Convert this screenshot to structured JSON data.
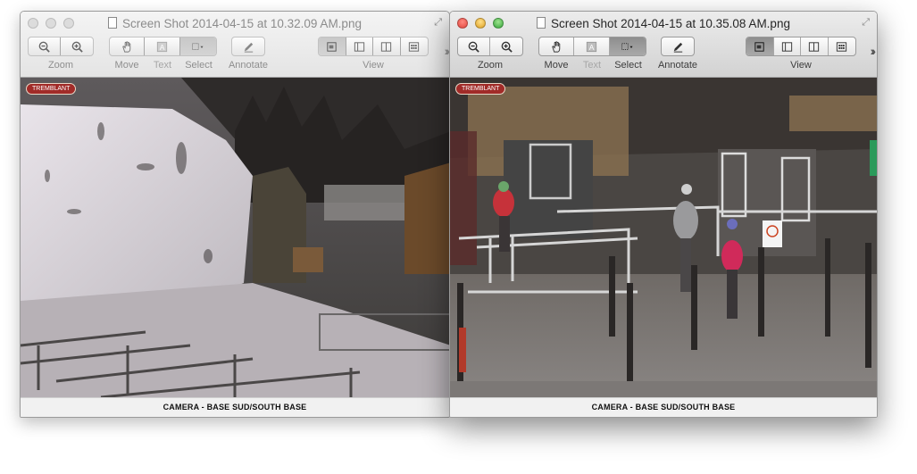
{
  "windows": [
    {
      "title": "Screen Shot 2014-04-15 at 10.32.09 AM.png",
      "active": false,
      "caption": "CAMERA - BASE SUD/SOUTH BASE",
      "logo_text": "TREMBLANT"
    },
    {
      "title": "Screen Shot 2014-04-15 at 10.35.08 AM.png",
      "active": true,
      "caption": "CAMERA - BASE SUD/SOUTH BASE",
      "logo_text": "TREMBLANT"
    }
  ],
  "toolbar": {
    "zoom_label": "Zoom",
    "move_label": "Move",
    "text_label": "Text",
    "select_label": "Select",
    "annotate_label": "Annotate",
    "view_label": "View",
    "zoom_buttons": [
      "zoom-out-icon",
      "zoom-in-icon"
    ],
    "tool_buttons": [
      "hand-icon",
      "text-tool-icon",
      "rect-select-icon"
    ],
    "view_buttons": [
      "single-page-icon",
      "sidebar-icon",
      "sidebar-right-icon",
      "contact-sheet-icon"
    ]
  },
  "colors": {
    "close": "#e2463f",
    "minimize": "#dfa123",
    "maximize": "#35a73a",
    "caption_bg": "#f1f1f1"
  }
}
